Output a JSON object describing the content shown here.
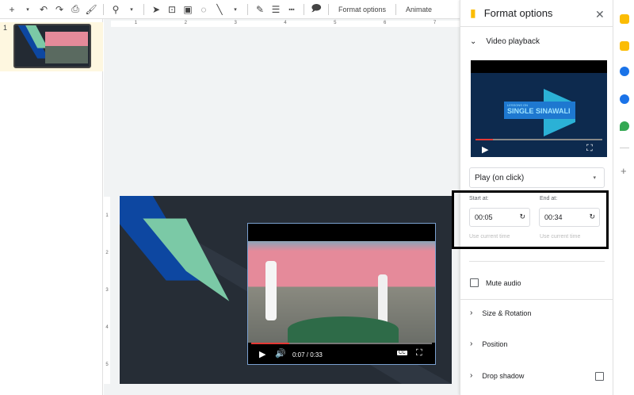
{
  "toolbar": {
    "items": [
      "new-slide",
      "dropdown",
      "undo",
      "redo",
      "print",
      "paint-format",
      "zoom",
      "dropdown",
      "select",
      "text-box",
      "image",
      "shape",
      "line",
      "pen",
      "border-weight",
      "border-dash",
      "comment"
    ],
    "format_options": "Format options",
    "animate": "Animate"
  },
  "ruler": {
    "h": [
      "1",
      "2",
      "3",
      "4",
      "5",
      "6",
      "7"
    ],
    "v": [
      "1",
      "2",
      "3",
      "4",
      "5"
    ]
  },
  "filmstrip": {
    "slide_number": "1"
  },
  "video": {
    "time": "0:07 / 0:33",
    "progress": 0.21,
    "cc": "CC"
  },
  "panel": {
    "title": "Format options",
    "video_playback": "Video playback",
    "preview_text_small": "LESSONS ON",
    "preview_text": "SINGLE SINAWALI",
    "play_mode": "Play (on click)",
    "start_label": "Start at:",
    "start_value": "00:05",
    "end_label": "End at:",
    "end_value": "00:34",
    "use_current": "Use current time",
    "mute": "Mute audio",
    "mute_checked": false,
    "size_rotation": "Size & Rotation",
    "position": "Position",
    "drop_shadow": "Drop shadow",
    "drop_shadow_checked": false
  },
  "colors": {
    "accent": "#fbbc04",
    "slide_bg": "#262d36",
    "slide_blue": "#0d47a1",
    "slide_teal": "#7bc9a6",
    "progress": "#e53935"
  }
}
